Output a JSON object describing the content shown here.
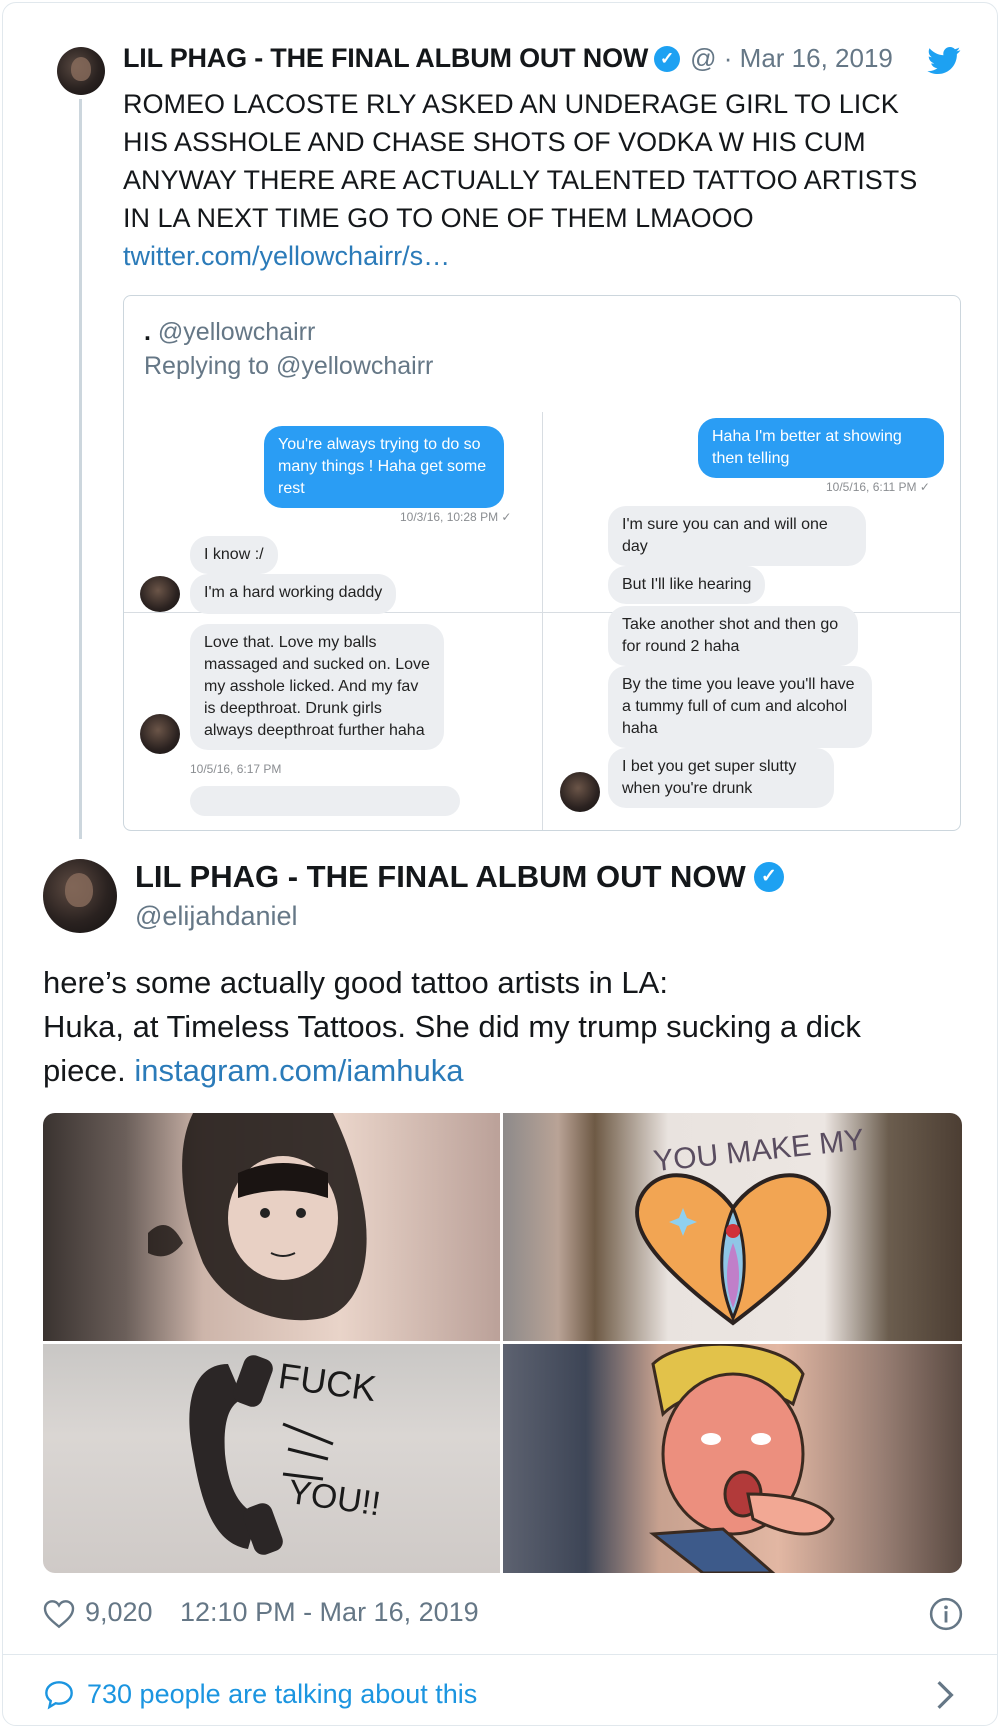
{
  "parent_tweet": {
    "name": "LIL PHAG - THE FINAL ALBUM OUT NOW",
    "meta": "@ · Mar 16, 2019",
    "text_lines": [
      "ROMEO LACOSTE RLY ASKED AN UNDERAGE GIRL TO LICK",
      "HIS ASSHOLE AND CHASE SHOTS OF VODKA W HIS CUM",
      "ANYWAY THERE ARE ACTUALLY TALENTED TATTOO ARTISTS",
      "IN LA NEXT TIME GO TO ONE OF THEM LMAOOO"
    ],
    "link": "twitter.com/yellowchairr/s…"
  },
  "quoted_tweet": {
    "name": ".",
    "handle": "@yellowchairr",
    "replying_to": "Replying to @yellowchairr",
    "panels": {
      "top_left": {
        "out_msg": "You're always trying to do so many things ! Haha get some rest",
        "out_ts": "10/3/16, 10:28 PM ✓",
        "in_msgs": [
          "I know :/",
          "I'm a hard working daddy"
        ]
      },
      "top_right": {
        "out_msg": "Haha I'm better at showing then telling",
        "out_ts": "10/5/16, 6:11 PM ✓",
        "in_msgs": [
          "I'm sure you can and will one day",
          "But I'll like hearing"
        ]
      },
      "bottom_left": {
        "in_msg": "Love that. Love my balls massaged and sucked on. Love my asshole licked. And my fav is deepthroat. Drunk girls always deepthroat further haha",
        "ts": "10/5/16, 6:17 PM"
      },
      "bottom_right": {
        "in_msgs": [
          "Take another shot and then go for round 2 haha",
          "By the time you leave you'll have a tummy full of cum and alcohol haha",
          "I bet you get super slutty when you're drunk"
        ]
      }
    }
  },
  "main_tweet": {
    "name": "LIL PHAG - THE FINAL ALBUM OUT NOW",
    "handle": "@elijahdaniel",
    "line1": "here’s some actually good tattoo artists in LA:",
    "line2": "Huka, at Timeless Tattoos. She did my trump sucking a dick",
    "line3_prefix": "piece.",
    "line3_link": "instagram.com/iamhuka",
    "photo_text": {
      "p2": "YOU MAKE MY",
      "p3_top": "FUCK",
      "p3_bottom": "YOU!!"
    }
  },
  "footer": {
    "likes": "9,020",
    "timestamp": "12:10 PM - Mar 16, 2019",
    "talking": "730 people are talking about this"
  },
  "icons": {
    "verified": "verified-badge-icon",
    "bird": "twitter-bird-icon",
    "heart": "heart-icon",
    "info": "info-icon",
    "comment": "comment-bubble-icon",
    "chevron": "chevron-right-icon"
  },
  "colors": {
    "link": "#2b7bb9",
    "verified": "#1da1f2",
    "secondary_text": "#657786",
    "talk": "#1b95e0",
    "outgoing_bubble": "#2a9df4"
  }
}
